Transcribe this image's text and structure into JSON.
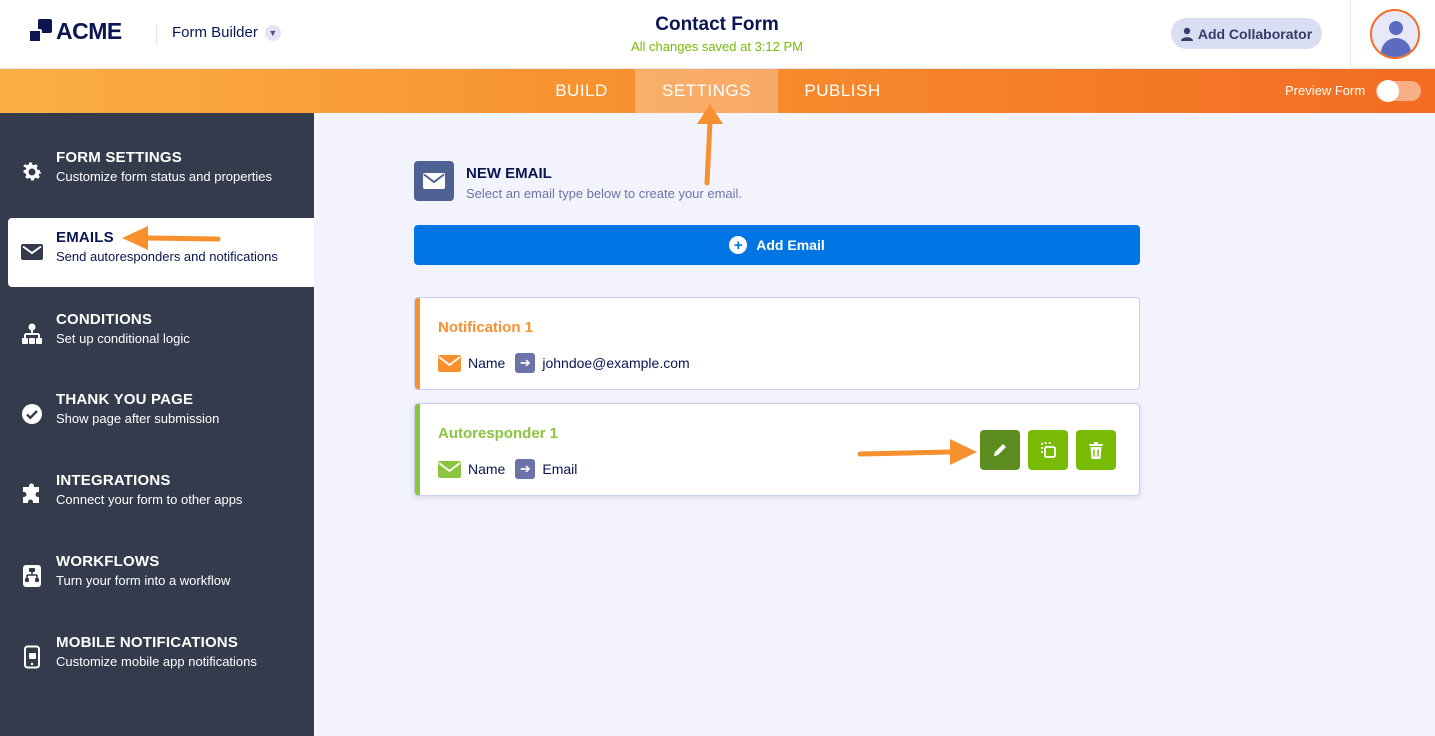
{
  "header": {
    "logo_text": "ACME",
    "app_name": "Form Builder",
    "form_title": "Contact Form",
    "save_status": "All changes saved at 3:12 PM",
    "collaborator_button": "Add Collaborator"
  },
  "nav": {
    "tabs": [
      {
        "label": "BUILD"
      },
      {
        "label": "SETTINGS",
        "active": true
      },
      {
        "label": "PUBLISH"
      }
    ],
    "preview_label": "Preview Form",
    "preview_on": false
  },
  "sidebar": {
    "items": [
      {
        "title": "FORM SETTINGS",
        "subtitle": "Customize form status and properties",
        "icon": "gear-icon"
      },
      {
        "title": "EMAILS",
        "subtitle": "Send autoresponders and notifications",
        "icon": "envelope-icon",
        "active": true
      },
      {
        "title": "CONDITIONS",
        "subtitle": "Set up conditional logic",
        "icon": "sitemap-icon"
      },
      {
        "title": "THANK YOU PAGE",
        "subtitle": "Show page after submission",
        "icon": "check-circle-icon"
      },
      {
        "title": "INTEGRATIONS",
        "subtitle": "Connect your form to other apps",
        "icon": "puzzle-icon"
      },
      {
        "title": "WORKFLOWS",
        "subtitle": "Turn your form into a workflow",
        "icon": "workflow-icon"
      },
      {
        "title": "MOBILE NOTIFICATIONS",
        "subtitle": "Customize mobile app notifications",
        "icon": "mobile-icon"
      }
    ]
  },
  "main": {
    "new_email_title": "NEW EMAIL",
    "new_email_subtitle": "Select an email type below to create your email.",
    "add_email_button": "Add Email",
    "emails": [
      {
        "title": "Notification 1",
        "from": "Name",
        "to": "johndoe@example.com",
        "color": "#f7902f"
      },
      {
        "title": "Autoresponder 1",
        "from": "Name",
        "to": "Email",
        "color": "#8bc43f"
      }
    ]
  },
  "colors": {
    "accent_orange": "#f36c22",
    "button_blue": "#0075e3",
    "sidebar_bg": "#343b4c",
    "edit_green": "#5b8c1e",
    "action_green": "#78bb07"
  }
}
